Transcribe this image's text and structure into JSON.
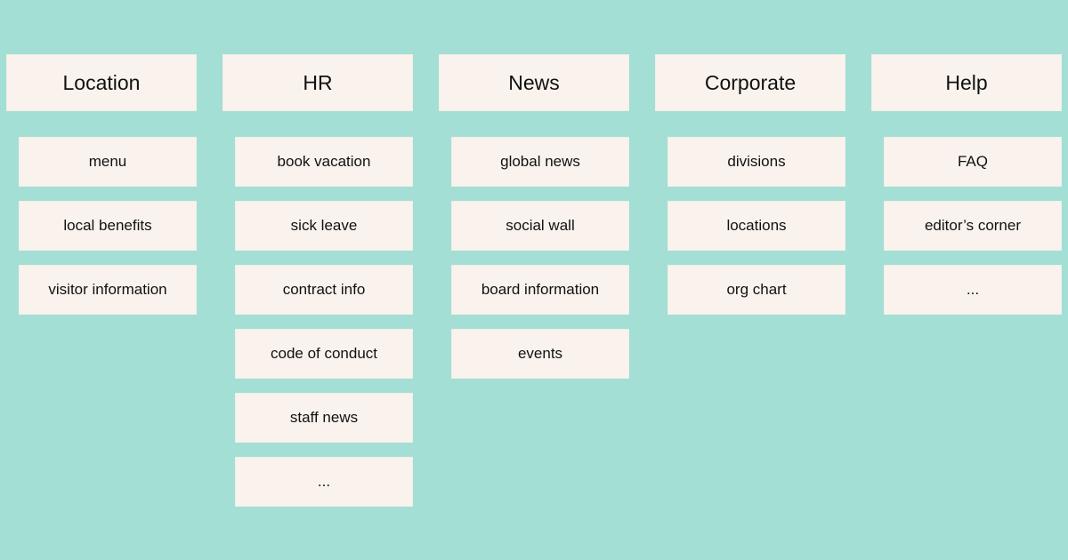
{
  "colors": {
    "background": "#a3dfd5",
    "card": "#faf3ed",
    "text": "#111111"
  },
  "columns": [
    {
      "title": "Location",
      "items": [
        "menu",
        "local benefits",
        "visitor information"
      ]
    },
    {
      "title": "HR",
      "items": [
        "book vacation",
        "sick leave",
        "contract info",
        "code of conduct",
        "staff news",
        "..."
      ]
    },
    {
      "title": "News",
      "items": [
        "global news",
        "social wall",
        "board information",
        "events"
      ]
    },
    {
      "title": "Corporate",
      "items": [
        "divisions",
        "locations",
        "org chart"
      ]
    },
    {
      "title": "Help",
      "items": [
        "FAQ",
        "editor’s corner",
        "..."
      ]
    }
  ]
}
